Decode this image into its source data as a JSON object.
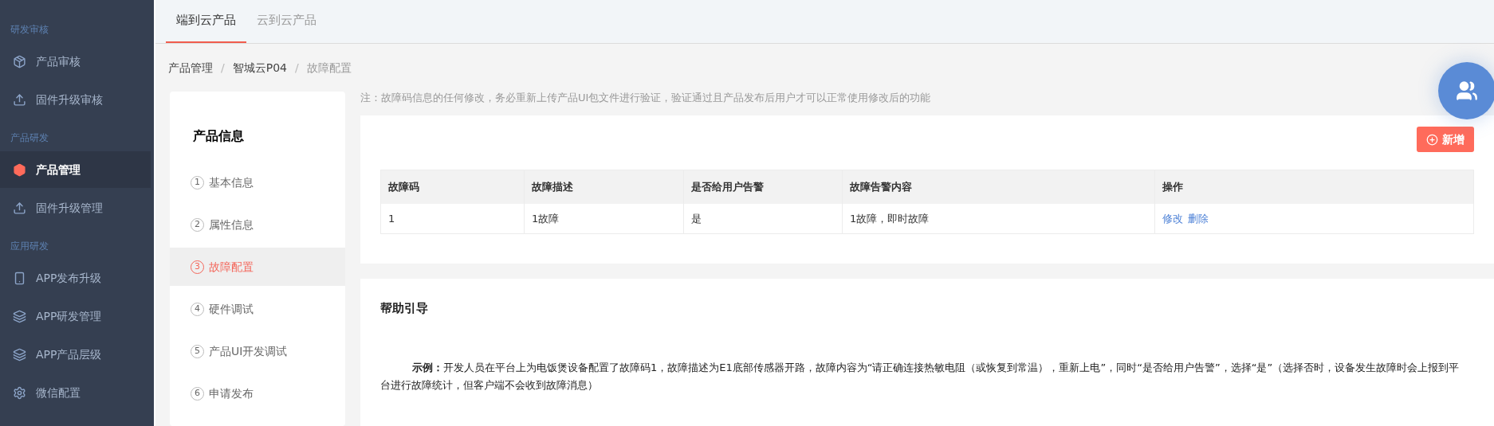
{
  "sidebar": {
    "groups": [
      {
        "title": "研发审核",
        "items": [
          {
            "label": "产品审核",
            "selected": false
          },
          {
            "label": "固件升级审核",
            "selected": false
          }
        ]
      },
      {
        "title": "产品研发",
        "items": [
          {
            "label": "产品管理",
            "selected": true
          },
          {
            "label": "固件升级管理",
            "selected": false
          }
        ]
      },
      {
        "title": "应用研发",
        "items": [
          {
            "label": "APP发布升级",
            "selected": false
          },
          {
            "label": "APP研发管理",
            "selected": false
          },
          {
            "label": "APP产品层级",
            "selected": false
          },
          {
            "label": "微信配置",
            "selected": false
          }
        ]
      }
    ]
  },
  "tabs": [
    {
      "label": "端到云产品",
      "selected": true
    },
    {
      "label": "云到云产品",
      "selected": false
    }
  ],
  "breadcrumb": [
    {
      "kind": "link",
      "text": "产品管理"
    },
    {
      "kind": "separator",
      "text": "/"
    },
    {
      "kind": "link",
      "text": "智城云P04"
    },
    {
      "kind": "separator",
      "text": "/"
    },
    {
      "kind": "current",
      "text": "故障配置"
    }
  ],
  "steps": {
    "title": "产品信息",
    "items": [
      {
        "number": "1",
        "label": "基本信息",
        "selected": false
      },
      {
        "number": "2",
        "label": "属性信息",
        "selected": false
      },
      {
        "number": "3",
        "label": "故障配置",
        "selected": true
      },
      {
        "number": "4",
        "label": "硬件调试",
        "selected": false
      },
      {
        "number": "5",
        "label": "产品UI开发调试",
        "selected": false
      },
      {
        "number": "6",
        "label": "申请发布",
        "selected": false
      }
    ]
  },
  "notice": "注：故障码信息的任何修改，务必重新上传产品UI包文件进行验证，验证通过且产品发布后用户才可以正常使用修改后的功能",
  "add_button": "新增",
  "table": {
    "columns": [
      "故障码",
      "故障描述",
      "是否给用户告警",
      "故障告警内容",
      "操作"
    ],
    "rows": [
      {
        "cells": [
          "1",
          "1故障",
          "是",
          "1故障，即时故障"
        ],
        "actions": [
          "修改",
          "删除"
        ]
      }
    ]
  },
  "help": {
    "title": "帮助引导",
    "text": "**示例：**开发人员在平台上为电饭煲设备配置了故障码1，故障描述为E1底部传感器开路，故障内容为“请正确连接热敏电阻（或恢复到常温），重新上电”，同时“是否给用户告警”，选择“是”（选择否时，设备发生故障时会上报到平台进行故障统计，但客户端不会收到故障消息）"
  }
}
